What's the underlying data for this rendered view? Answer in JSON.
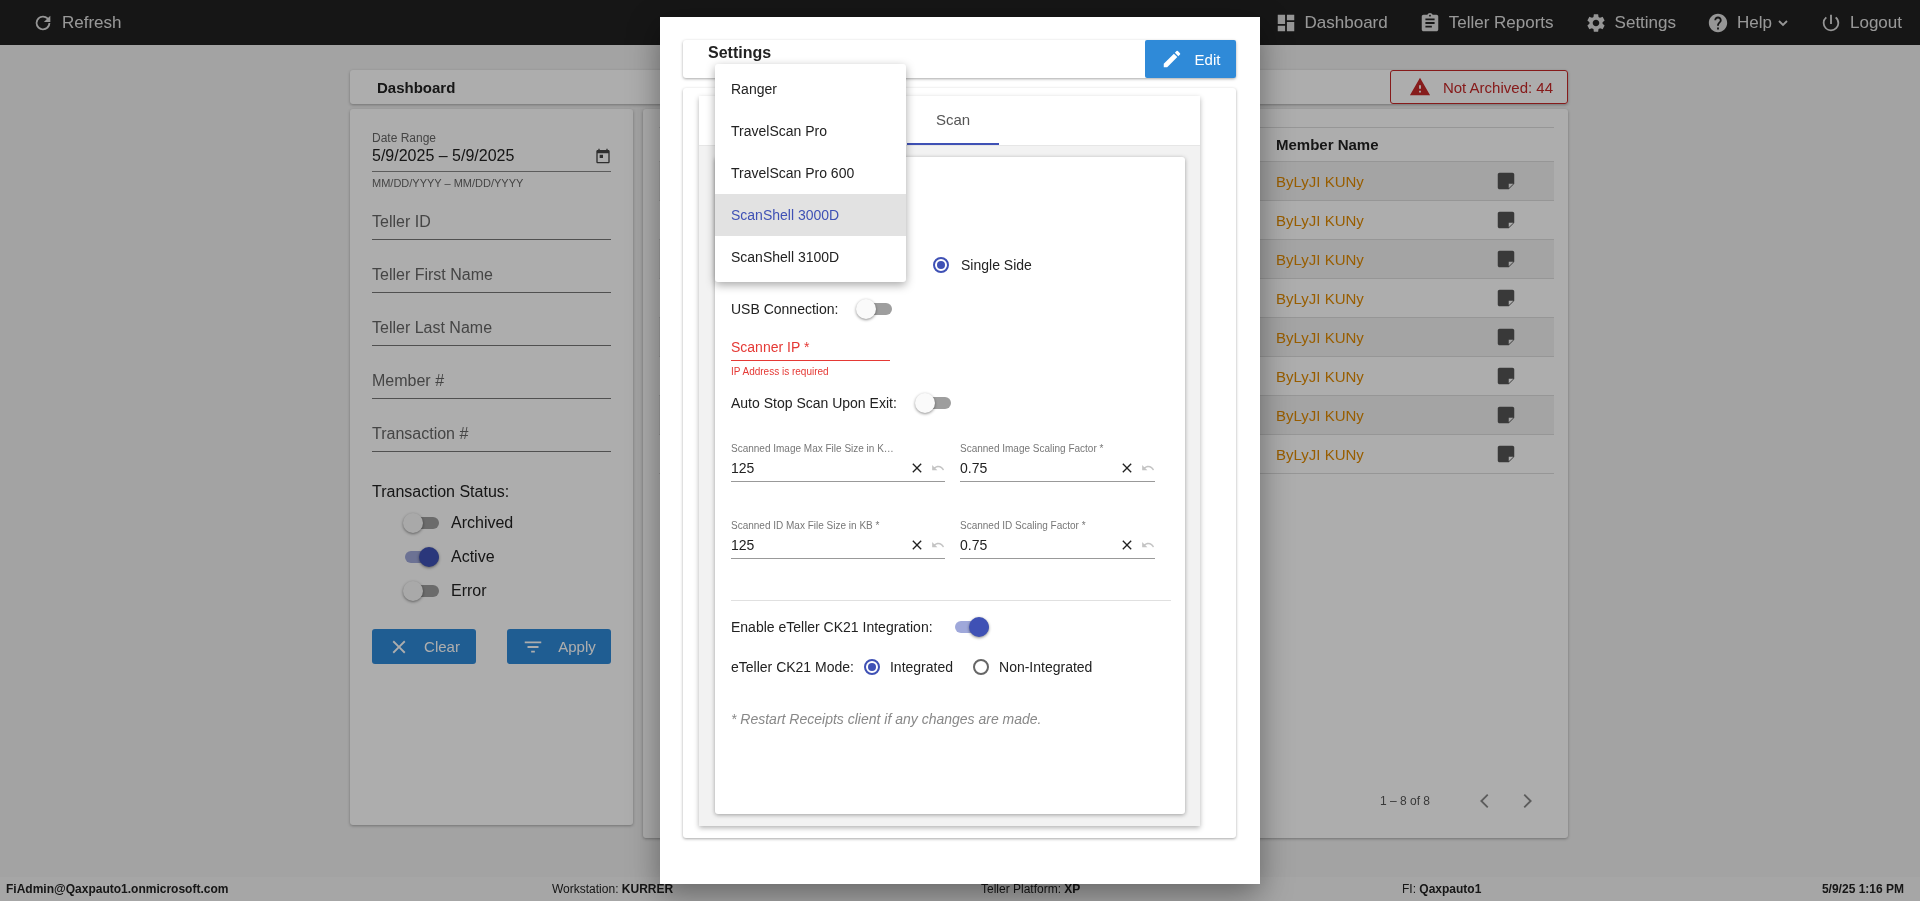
{
  "top_bar": {
    "refresh": "Refresh",
    "nav": [
      {
        "kind": "dashboard",
        "label": "Dashboard"
      },
      {
        "kind": "reports",
        "label": "Teller Reports"
      },
      {
        "kind": "settings",
        "label": "Settings"
      },
      {
        "kind": "help",
        "label": "Help"
      },
      {
        "kind": "logout",
        "label": "Logout"
      }
    ]
  },
  "dashboard": {
    "title": "Dashboard",
    "not_archived": "Not Archived: 44"
  },
  "filters": {
    "date_range": {
      "label": "Date Range",
      "value": "5/9/2025 – 5/9/2025",
      "hint": "MM/DD/YYYY – MM/DD/YYYY"
    },
    "fields": [
      {
        "placeholder": "Teller ID"
      },
      {
        "placeholder": "Teller First Name"
      },
      {
        "placeholder": "Teller Last Name"
      },
      {
        "placeholder": "Member #"
      },
      {
        "placeholder": "Transaction #"
      }
    ],
    "status_label": "Transaction Status:",
    "statuses": [
      {
        "label": "Archived",
        "on": false
      },
      {
        "label": "Active",
        "on": true
      },
      {
        "label": "Error",
        "on": false
      }
    ],
    "buttons": [
      {
        "kind": "clear",
        "label": "Clear"
      },
      {
        "kind": "apply",
        "label": "Apply"
      }
    ]
  },
  "table": {
    "columns": [
      "Member Name"
    ],
    "rows": [
      {
        "member_name": "ByLyJI KUNy"
      },
      {
        "member_name": "ByLyJI KUNy"
      },
      {
        "member_name": "ByLyJI KUNy"
      },
      {
        "member_name": "ByLyJI KUNy"
      },
      {
        "member_name": "ByLyJI KUNy"
      },
      {
        "member_name": "ByLyJI KUNy"
      },
      {
        "member_name": "ByLyJI KUNy"
      },
      {
        "member_name": "ByLyJI KUNy"
      }
    ],
    "pagination": "1 – 8 of 8"
  },
  "settings_dialog": {
    "title": "Settings",
    "edit_button": "Edit",
    "tabs": [
      {
        "label": "Scan",
        "selected": true
      }
    ],
    "scanner_options": [
      {
        "label": "Ranger",
        "selected": false
      },
      {
        "label": "TravelScan Pro",
        "selected": false
      },
      {
        "label": "TravelScan Pro 600",
        "selected": false
      },
      {
        "label": "ScanShell 3000D",
        "selected": true
      },
      {
        "label": "ScanShell 3100D",
        "selected": false
      }
    ],
    "scan_mode_options": [
      {
        "label": "Single Side",
        "selected": true
      }
    ],
    "usb_connection": {
      "label": "USB Connection:",
      "on": false
    },
    "scanner_ip": {
      "label": "Scanner IP *",
      "error": "IP Address is required"
    },
    "auto_stop": {
      "label": "Auto Stop Scan Upon Exit:",
      "on": false
    },
    "size_fields": [
      {
        "label": "Scanned Image Max File Size in K…",
        "value": "125"
      },
      {
        "label": "Scanned Image Scaling Factor *",
        "value": "0.75"
      },
      {
        "label": "Scanned ID Max File Size in KB *",
        "value": "125"
      },
      {
        "label": "Scanned ID Scaling Factor *",
        "value": "0.75"
      }
    ],
    "integration": {
      "label": "Enable eTeller CK21 Integration:",
      "on": true
    },
    "mode": {
      "label": "eTeller CK21 Mode:",
      "options": [
        {
          "label": "Integrated",
          "selected": true
        },
        {
          "label": "Non-Integrated",
          "selected": false
        }
      ]
    },
    "note": "* Restart Receipts client if any changes are made."
  },
  "status_bar": {
    "user": "FiAdmin@Qaxpauto1.onmicrosoft.com",
    "workstation": "Workstation: **KURRER**",
    "platform": "Teller Platform: **XP**",
    "fi": "FI: **Qaxpauto1**",
    "datetime": "5/9/25 1:16 PM"
  }
}
